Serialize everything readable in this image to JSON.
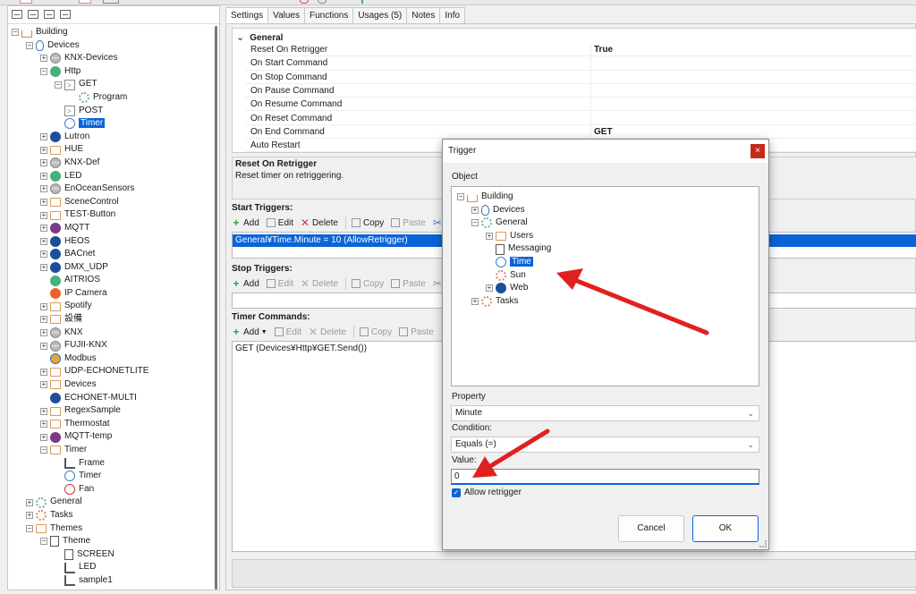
{
  "tabs": [
    "Settings",
    "Values",
    "Functions",
    "Usages (5)",
    "Notes",
    "Info"
  ],
  "left_tree": [
    {
      "label": "Building",
      "icon": "house-icon",
      "level": 0,
      "exp": "-"
    },
    {
      "label": "Devices",
      "icon": "bulb-icon",
      "level": 1,
      "exp": "-"
    },
    {
      "label": "KNX-Devices",
      "icon": "knx-icon",
      "level": 2,
      "exp": "+"
    },
    {
      "label": "Http",
      "icon": "http-icon",
      "level": 2,
      "exp": "-"
    },
    {
      "label": "GET",
      "icon": "terminal-icon",
      "level": 3,
      "exp": "-"
    },
    {
      "label": "Program",
      "icon": "gear-icon",
      "level": 4,
      "exp": ""
    },
    {
      "label": "POST",
      "icon": "terminal-icon",
      "level": 3,
      "exp": ""
    },
    {
      "label": "Timer",
      "icon": "clock-icon",
      "level": 3,
      "exp": "",
      "selected": true
    },
    {
      "label": "Lutron",
      "icon": "lutron-icon",
      "level": 2,
      "exp": "+"
    },
    {
      "label": "HUE",
      "icon": "folder-icon",
      "level": 2,
      "exp": "+"
    },
    {
      "label": "KNX-Def",
      "icon": "knx-icon",
      "level": 2,
      "exp": "+"
    },
    {
      "label": "LED",
      "icon": "http-icon",
      "level": 2,
      "exp": "+"
    },
    {
      "label": "EnOceanSensors",
      "icon": "knx-icon",
      "level": 2,
      "exp": "+"
    },
    {
      "label": "SceneControl",
      "icon": "folder-icon",
      "level": 2,
      "exp": "+"
    },
    {
      "label": "TEST-Button",
      "icon": "folder-icon",
      "level": 2,
      "exp": "+"
    },
    {
      "label": "MQTT",
      "icon": "mqtt-icon",
      "level": 2,
      "exp": "+"
    },
    {
      "label": "HEOS",
      "icon": "lutron-icon",
      "level": 2,
      "exp": "+"
    },
    {
      "label": "BACnet",
      "icon": "lutron-icon",
      "level": 2,
      "exp": "+"
    },
    {
      "label": "DMX_UDP",
      "icon": "lutron-icon",
      "level": 2,
      "exp": "+"
    },
    {
      "label": "AITRIOS",
      "icon": "http-icon",
      "level": 2,
      "exp": ""
    },
    {
      "label": "IP Camera",
      "icon": "camera-icon",
      "level": 2,
      "exp": ""
    },
    {
      "label": "Spotify",
      "icon": "folder-icon",
      "level": 2,
      "exp": "+"
    },
    {
      "label": "設備",
      "icon": "folder-icon",
      "level": 2,
      "exp": "+"
    },
    {
      "label": "KNX",
      "icon": "knx-icon",
      "level": 2,
      "exp": "+"
    },
    {
      "label": "FUJII-KNX",
      "icon": "knx-icon",
      "level": 2,
      "exp": "+"
    },
    {
      "label": "Modbus",
      "icon": "modbus-icon",
      "level": 2,
      "exp": ""
    },
    {
      "label": "UDP-ECHONETLITE",
      "icon": "folder-icon",
      "level": 2,
      "exp": "+"
    },
    {
      "label": "Devices",
      "icon": "folder-icon",
      "level": 2,
      "exp": "+"
    },
    {
      "label": "ECHONET-MULTI",
      "icon": "lutron-icon",
      "level": 2,
      "exp": ""
    },
    {
      "label": "RegexSample",
      "icon": "folder-icon",
      "level": 2,
      "exp": "+"
    },
    {
      "label": "Thermostat",
      "icon": "folder-icon",
      "level": 2,
      "exp": "+"
    },
    {
      "label": "MQTT-temp",
      "icon": "mqtt-icon",
      "level": 2,
      "exp": "+"
    },
    {
      "label": "Timer",
      "icon": "folder-icon",
      "level": 2,
      "exp": "-"
    },
    {
      "label": "Frame",
      "icon": "frame-icon",
      "level": 3,
      "exp": ""
    },
    {
      "label": "Timer",
      "icon": "clock-icon",
      "level": 3,
      "exp": ""
    },
    {
      "label": "Fan",
      "icon": "clock-red-icon",
      "level": 3,
      "exp": ""
    },
    {
      "label": "General",
      "icon": "gear-icon",
      "level": 1,
      "exp": "+"
    },
    {
      "label": "Tasks",
      "icon": "tasks-icon",
      "level": 1,
      "exp": "+"
    },
    {
      "label": "Themes",
      "icon": "folder-icon",
      "level": 1,
      "exp": "-"
    },
    {
      "label": "Theme",
      "icon": "doc-icon",
      "level": 2,
      "exp": "-"
    },
    {
      "label": "SCREEN",
      "icon": "doc-icon",
      "level": 3,
      "exp": ""
    },
    {
      "label": "LED",
      "icon": "frame-icon",
      "level": 3,
      "exp": ""
    },
    {
      "label": "sample1",
      "icon": "frame-icon",
      "level": 3,
      "exp": ""
    }
  ],
  "properties": {
    "category": "General",
    "rows": [
      {
        "name": "Reset On Retrigger",
        "value": "True"
      },
      {
        "name": "On Start Command",
        "value": ""
      },
      {
        "name": "On Stop Command",
        "value": ""
      },
      {
        "name": "On Pause Command",
        "value": ""
      },
      {
        "name": "On Resume Command",
        "value": ""
      },
      {
        "name": "On Reset Command",
        "value": ""
      },
      {
        "name": "On End Command",
        "value": "GET"
      },
      {
        "name": "Auto Restart",
        "value": ""
      }
    ]
  },
  "description": {
    "title": "Reset On Retrigger",
    "text": "Reset timer on retriggering."
  },
  "start_triggers": {
    "label": "Start Triggers:",
    "item": "General¥Time.Minute = 10 (AllowRetrigger)"
  },
  "stop_triggers": {
    "label": "Stop Triggers:"
  },
  "timer_commands": {
    "label": "Timer Commands:",
    "item": "GET (Devices¥Http¥GET.Send())"
  },
  "toolbar": {
    "add": "Add",
    "edit": "Edit",
    "delete": "Delete",
    "copy": "Copy",
    "paste": "Paste"
  },
  "dialog": {
    "title": "Trigger",
    "close": "×",
    "object_label": "Object",
    "object_tree": [
      {
        "label": "Building",
        "icon": "house-icon",
        "level": 0,
        "exp": "-"
      },
      {
        "label": "Devices",
        "icon": "bulb-icon",
        "level": 1,
        "exp": "+"
      },
      {
        "label": "General",
        "icon": "gear-icon",
        "level": 1,
        "exp": "-"
      },
      {
        "label": "Users",
        "icon": "users-icon",
        "level": 2,
        "exp": "+"
      },
      {
        "label": "Messaging",
        "icon": "mail-icon",
        "level": 2,
        "exp": ""
      },
      {
        "label": "Time",
        "icon": "clock-icon",
        "level": 2,
        "exp": "",
        "selected": true
      },
      {
        "label": "Sun",
        "icon": "sun-icon",
        "level": 2,
        "exp": ""
      },
      {
        "label": "Web",
        "icon": "globe-icon",
        "level": 2,
        "exp": "+"
      },
      {
        "label": "Tasks",
        "icon": "tasks-icon",
        "level": 1,
        "exp": "+"
      }
    ],
    "property_label": "Property",
    "property_value": "Minute",
    "condition_label": "Condition:",
    "condition_value": "Equals (=)",
    "value_label": "Value:",
    "value": "0",
    "allow_retrigger": "Allow retrigger",
    "cancel": "Cancel",
    "ok": "OK"
  },
  "colors": {
    "selection": "#0a64d8",
    "arrow": "#e02020",
    "close": "#c42b1c"
  }
}
